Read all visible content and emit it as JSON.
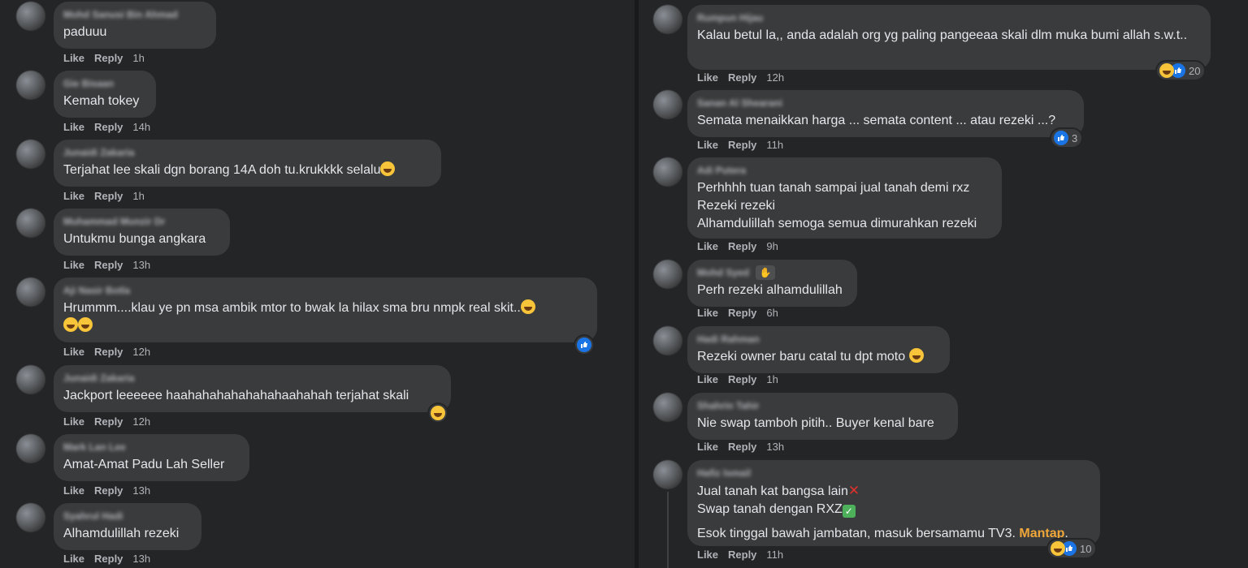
{
  "like_label": "Like",
  "reply_label": "Reply",
  "left_comments": [
    {
      "author": "Mohd Sanusi Bin Ahmad",
      "text": "paduuu",
      "time": "1h"
    },
    {
      "author": "Gie Bisaan",
      "text": "Kemah tokey",
      "time": "14h"
    },
    {
      "author": "Junaidi Zakaria",
      "text": "Terjahat lee skali dgn borang 14A doh tu.krukkkk selalu",
      "time": "1h"
    },
    {
      "author": "Muhammad Munzir Dr",
      "text": "Untukmu bunga angkara",
      "time": "13h"
    },
    {
      "author": "Aji Nasir Botla",
      "text": "Hrummm....klau ye pn msa ambik mtor to bwak la hilax sma bru nmpk real skit..",
      "time": "12h"
    },
    {
      "author": "Junaidi Zakaria",
      "text": "Jackport leeeeee haahahahahahahahaahahah terjahat skali",
      "time": "12h"
    },
    {
      "author": "Mark Lan Lee",
      "text": "Amat-Amat Padu Lah Seller",
      "time": "13h"
    },
    {
      "author": "Syahrul Hadi",
      "text": "Alhamdulillah rezeki",
      "time": "13h"
    }
  ],
  "right_comments": [
    {
      "author": "Rumpun Hijau",
      "text": "Kalau betul la,, anda adalah org yg paling pangeeaa skali dlm muka bumi allah s.w.t..",
      "time": "12h",
      "reaction_count": "20"
    },
    {
      "author": "Sanan Al Shearani",
      "text": "Semata menaikkan harga ... semata content ... atau rezeki ...?",
      "time": "11h",
      "reaction_count": "3"
    },
    {
      "author": "Adi Putera",
      "lines": [
        "Perhhhh tuan tanah sampai jual tanah demi rxz",
        "Rezeki rezeki",
        "Alhamdulillah semoga semua dimurahkan rezeki"
      ],
      "time": "9h"
    },
    {
      "author": "Mohd Syed",
      "text": "Perh rezeki alhamdulillah",
      "time": "6h"
    },
    {
      "author": "Hadi Rahman",
      "text": "Rezeki owner baru catal tu dpt moto",
      "time": "1h"
    },
    {
      "author": "Shahrin Tahir",
      "text": "Nie swap tambоh pitih.. Buyer kenal bare",
      "time": "13h"
    },
    {
      "author": "Hafiz Ismail",
      "line1": "Jual tanah kat bangsa lain",
      "line2": "Swap tanah dengan RXZ",
      "line3_pre": "Esok tinggal bawah jambatan, masuk bersamamu TV3. ",
      "mention": "Mantap",
      "line3_post": ".",
      "time": "11h",
      "reaction_count": "10"
    }
  ],
  "colors": {
    "background": "#242526",
    "bubble": "#3a3b3c",
    "text": "#e4e6eb",
    "meta": "#b0b3b8",
    "like_blue": "#1b74e4",
    "mention": "#f0a73a"
  }
}
